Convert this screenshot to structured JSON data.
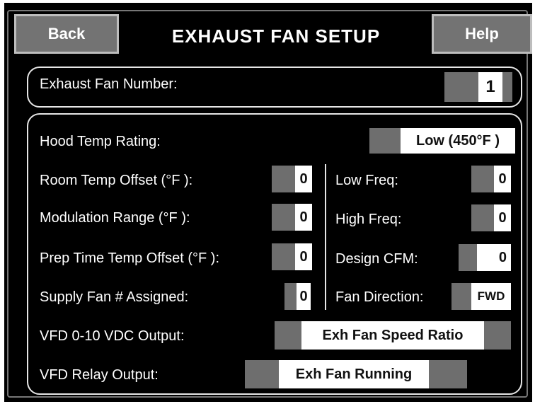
{
  "header": {
    "back_label": "Back",
    "title": "EXHAUST FAN SETUP",
    "help_label": "Help"
  },
  "fan_number": {
    "label": "Exhaust Fan Number:",
    "value": "1"
  },
  "settings": {
    "hood_temp_rating": {
      "label": "Hood Temp Rating:",
      "value": "Low (450°F )"
    },
    "room_temp_offset": {
      "label": "Room Temp Offset (°F ):",
      "value": "0"
    },
    "modulation_range": {
      "label": "Modulation Range (°F ):",
      "value": "0"
    },
    "prep_time_temp_offset": {
      "label": "Prep Time Temp Offset (°F ):",
      "value": "0"
    },
    "supply_fan_assigned": {
      "label": "Supply Fan # Assigned:",
      "value": "0"
    },
    "low_freq": {
      "label": "Low Freq:",
      "value": "0"
    },
    "high_freq": {
      "label": "High Freq:",
      "value": "0"
    },
    "design_cfm": {
      "label": "Design CFM:",
      "value": "0"
    },
    "fan_direction": {
      "label": "Fan Direction:",
      "value": "FWD"
    },
    "vfd_output": {
      "label": "VFD 0-10 VDC Output:",
      "value": "Exh Fan Speed Ratio"
    },
    "vfd_relay_output": {
      "label": "VFD Relay Output:",
      "value": "Exh Fan Running"
    }
  }
}
